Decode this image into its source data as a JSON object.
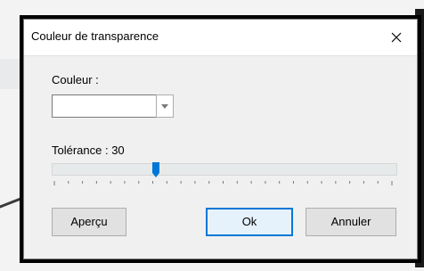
{
  "dialog": {
    "title": "Couleur de transparence",
    "colors": {
      "accent": "#0078d7"
    }
  },
  "color_section": {
    "label": "Couleur :",
    "value": "",
    "swatch_color": "#ffffff"
  },
  "tolerance": {
    "label": "Tolérance : 30",
    "value": 30
  },
  "buttons": {
    "preview": "Aperçu",
    "ok": "Ok",
    "cancel": "Annuler"
  }
}
